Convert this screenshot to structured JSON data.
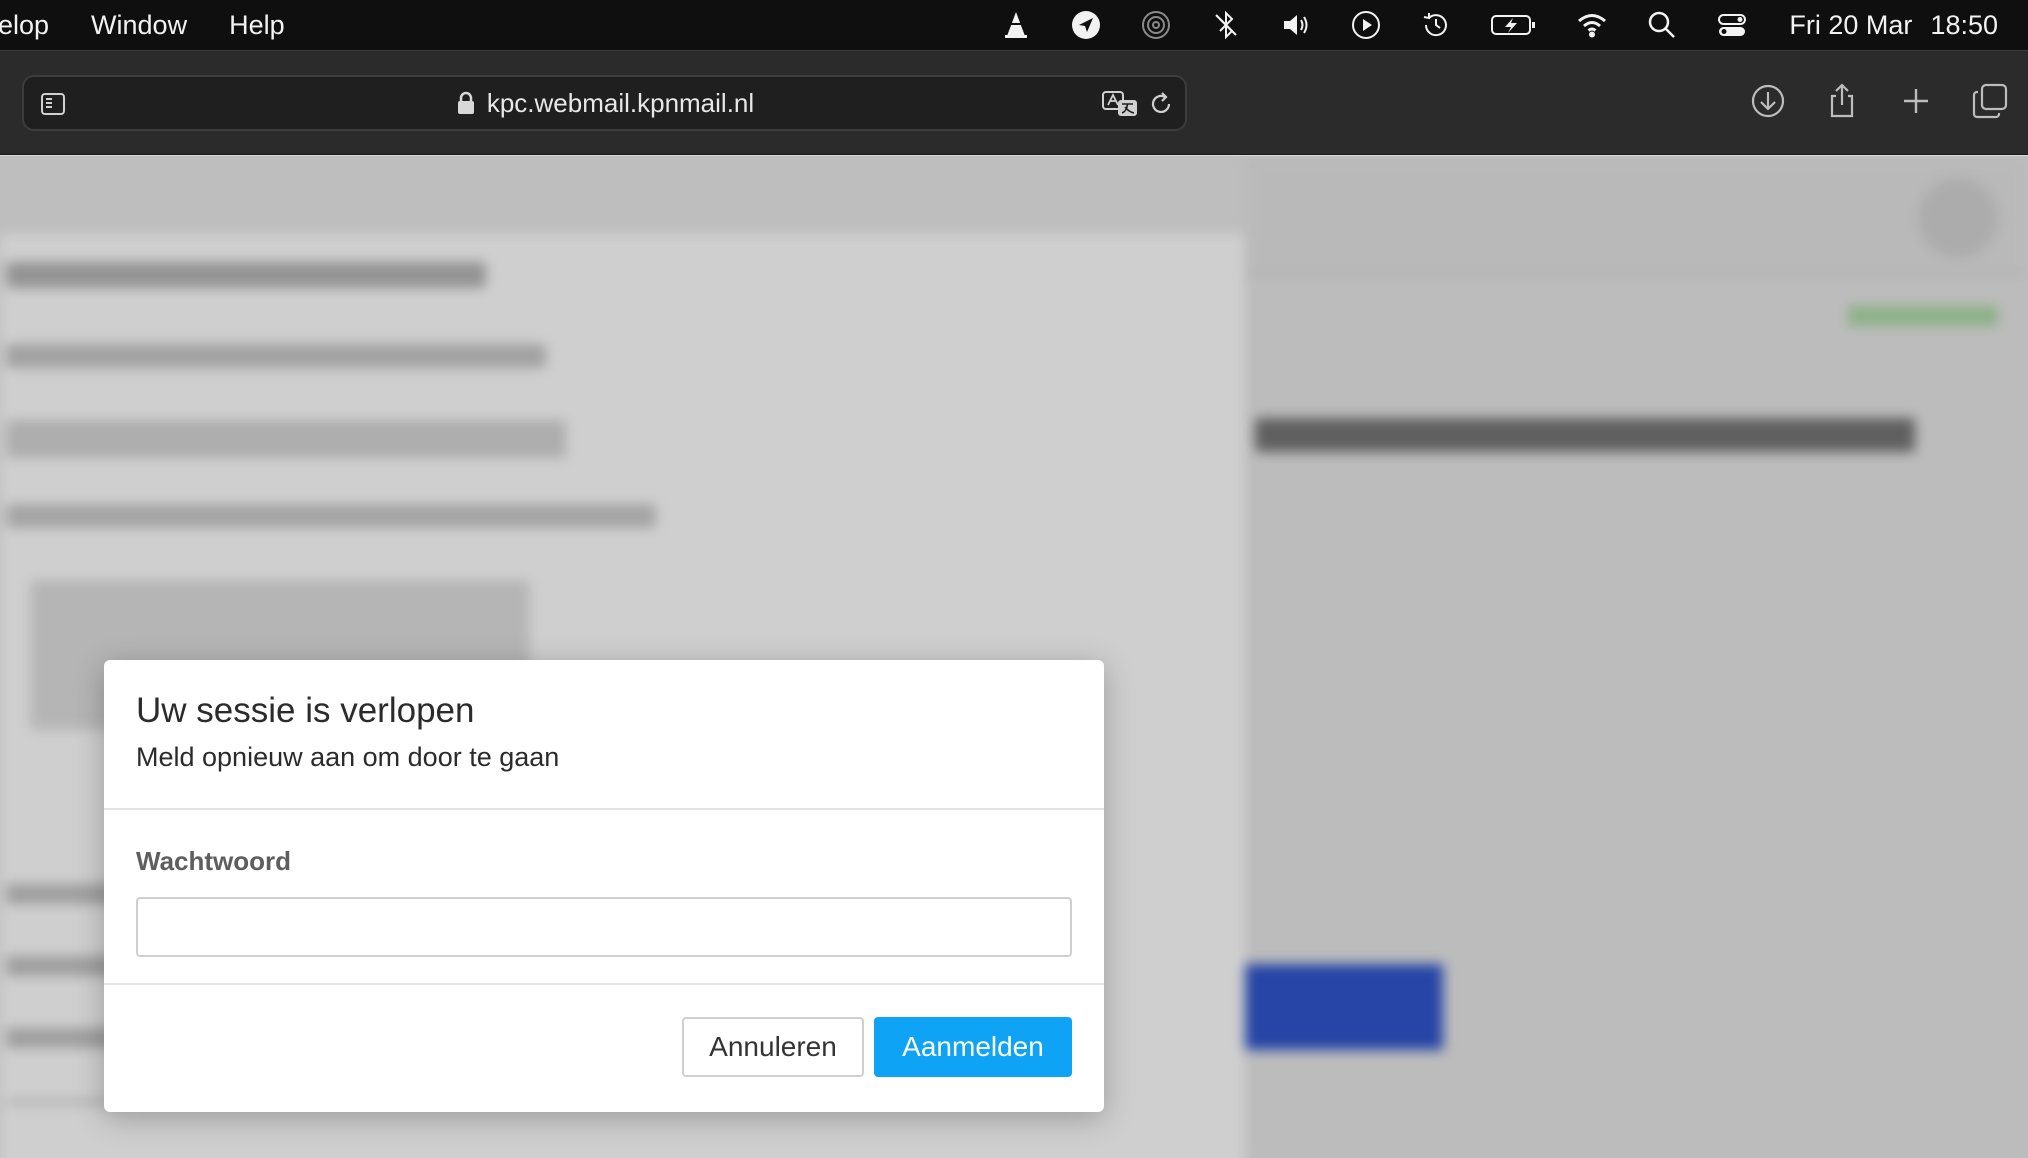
{
  "menubar": {
    "menus": [
      "elop",
      "Window",
      "Help"
    ],
    "clock": {
      "date": "Fri 20 Mar",
      "time": "18:50"
    },
    "status_icons": [
      "vlc-icon",
      "location-icon",
      "airdrop-icon",
      "bluetooth-icon",
      "volume-icon",
      "play-icon",
      "time-machine-icon",
      "battery-icon",
      "wifi-icon",
      "spotlight-icon",
      "control-center-icon"
    ]
  },
  "browser": {
    "url": "kpc.webmail.kpnmail.nl",
    "toolbar_icons": [
      "download-icon",
      "share-icon",
      "new-tab-icon",
      "tabs-overview-icon"
    ]
  },
  "modal": {
    "title": "Uw sessie is verlopen",
    "subtitle": "Meld opnieuw aan om door te gaan",
    "password_label": "Wachtwoord",
    "password_value": "",
    "cancel_label": "Annuleren",
    "login_label": "Aanmelden"
  },
  "colors": {
    "primary_button": "#0fa3f5",
    "menubar_bg": "#0f0f0f",
    "toolbar_bg": "#2b2b2b"
  }
}
